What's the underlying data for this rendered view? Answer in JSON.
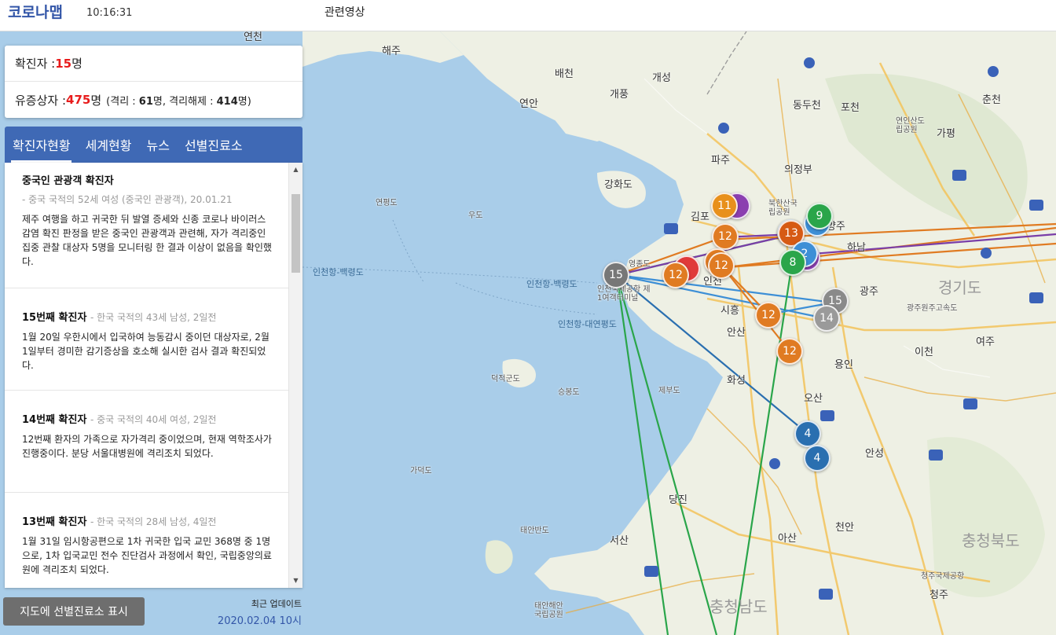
{
  "header": {
    "brand": "코로나맵",
    "time": "10:16:31",
    "videos_link": "관련영상"
  },
  "stats": {
    "confirmed_label": "확진자 : ",
    "confirmed_value": "15",
    "confirmed_unit": "명",
    "suspected_label": "유증상자 : ",
    "suspected_value": "475",
    "suspected_unit": "명",
    "detail_open": "(격리 : ",
    "isolated_value": "61",
    "detail_mid": "명, 격리해제 : ",
    "released_value": "414",
    "detail_close": "명)"
  },
  "tabs": [
    "확진자현황",
    "세계현황",
    "뉴스",
    "선별진료소"
  ],
  "news": [
    {
      "title": "중국인 관광객 확진자",
      "meta": "- 중국 국적의 52세 여성 (중국인 관광객), 20.01.21",
      "body": "제주 여행을 하고 귀국한 뒤 발열 증세와 신종 코로나 바이러스 감염 확진 판정을 받은 중국인 관광객과 관련해, 자가 격리중인 집중 관찰 대상자 5명을 모니터링 한 결과 이상이 없음을 확인했다."
    },
    {
      "title": "15번째 확진자",
      "meta": "- 한국 국적의 43세 남성, 2일전",
      "body": "1월 20일 우한시에서 입국하여 능동감시 중이던 대상자로, 2월 1일부터 경미한 감기증상을 호소해 실시한 검사 결과 확진되었다."
    },
    {
      "title": "14번째 확진자",
      "meta": "- 중국 국적의 40세 여성, 2일전",
      "body": "12번째 환자의 가족으로 자가격리 중이었으며, 현재 역학조사가 진행중이다. 분당 서울대병원에 격리조치 되었다."
    },
    {
      "title": "13번째 확진자",
      "meta": "- 한국 국적의 28세 남성, 4일전",
      "body": "1월 31일 임시항공편으로 1차 귀국한 입국 교민 368명 중 1명으로, 1차 입국교민 전수 진단검사 과정에서 확인, 국립중앙의료원에 격리조치 되었다."
    }
  ],
  "footer": {
    "show_clinics_button": "지도에 선별진료소 표시",
    "update_label": "최근 업데이트",
    "update_time": "2020.02.04 10시"
  },
  "map": {
    "places": [
      "해주",
      "배천",
      "개성",
      "개풍",
      "연안",
      "동두천",
      "포천",
      "춘천",
      "가평",
      "연천",
      "파주",
      "의정부",
      "강화도",
      "김포",
      "연평도",
      "우도",
      "영종도",
      "인천",
      "남양주",
      "하남",
      "광주",
      "경기도",
      "시흥",
      "안산",
      "이천",
      "여주",
      "용인",
      "화성",
      "오산",
      "덕적군도",
      "승봉도",
      "제부도",
      "안성",
      "가덕도",
      "당진",
      "태안반도",
      "서산",
      "아산",
      "천안",
      "충청북도",
      "청주",
      "충청남도",
      "인천국제공항 제1여객터미널",
      "청주국제공항",
      "연인산도립공원",
      "북한산국립공원",
      "태안해안국립공원",
      "광주원주고속도"
    ],
    "sea_routes": [
      "인천항-백령도",
      "인천항-백령도",
      "인천항-대연평도",
      "인천-평택"
    ],
    "markers": [
      {
        "label": "11",
        "color": "#e8901b"
      },
      {
        "label": "9",
        "color": "#2aa54a"
      },
      {
        "label": "12",
        "color": "#e07b22"
      },
      {
        "label": "13",
        "color": "#d65a14"
      },
      {
        "label": "2",
        "color": "#3d8fd6"
      },
      {
        "label": "12",
        "color": "#e07b22"
      },
      {
        "label": "8",
        "color": "#2aa54a"
      },
      {
        "label": "15",
        "color": "#777777"
      },
      {
        "label": "12",
        "color": "#e07b22"
      },
      {
        "label": "15",
        "color": "#8a8a8a"
      },
      {
        "label": "14",
        "color": "#9a9a9a"
      },
      {
        "label": "12",
        "color": "#e07b22"
      },
      {
        "label": "12",
        "color": "#e07b22"
      },
      {
        "label": "4",
        "color": "#2a6fb0"
      },
      {
        "label": "4",
        "color": "#2a6fb0"
      }
    ]
  }
}
